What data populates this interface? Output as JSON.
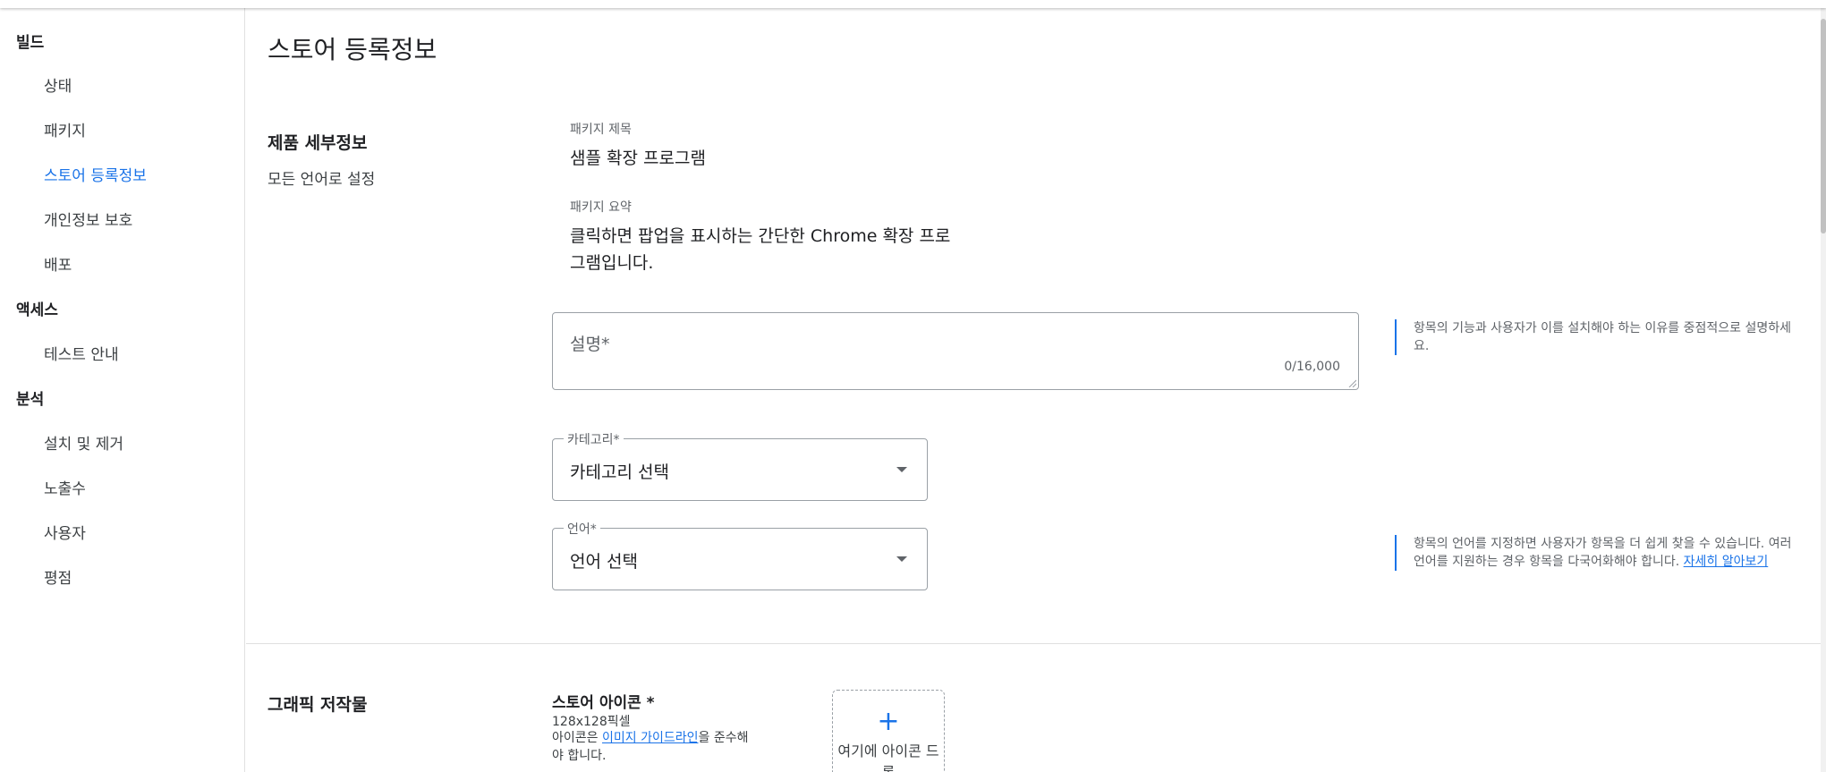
{
  "sidebar": {
    "sections": [
      {
        "label": "빌드",
        "items": [
          {
            "label": "상태"
          },
          {
            "label": "패키지"
          },
          {
            "label": "스토어 등록정보"
          },
          {
            "label": "개인정보 보호"
          },
          {
            "label": "배포"
          }
        ]
      },
      {
        "label": "액세스",
        "items": [
          {
            "label": "테스트 안내"
          }
        ]
      },
      {
        "label": "분석",
        "items": [
          {
            "label": "설치 및 제거"
          },
          {
            "label": "노출수"
          },
          {
            "label": "사용자"
          },
          {
            "label": "평점"
          }
        ]
      }
    ],
    "active_item": "스토어 등록정보"
  },
  "page": {
    "title": "스토어 등록정보"
  },
  "product_details": {
    "title": "제품 세부정보",
    "subtitle": "모든 언어로 설정",
    "package_title_label": "패키지 제목",
    "package_title_value": "샘플 확장 프로그램",
    "package_summary_label": "패키지 요약",
    "package_summary_value": "클릭하면 팝업을 표시하는 간단한 Chrome 확장 프로그램입니다.",
    "description": {
      "placeholder": "설명*",
      "counter": "0/16,000",
      "hint": "항목의 기능과 사용자가 이를 설치해야 하는 이유를 중점적으로 설명하세요."
    },
    "category": {
      "label": "카테고리*",
      "value": "카테고리 선택"
    },
    "language": {
      "label": "언어*",
      "value": "언어 선택",
      "hint": "항목의 언어를 지정하면 사용자가 항목을 더 쉽게 찾을 수 있습니다. 여러 언어를 지원하는 경우 항목을 다국어화해야 합니다. ",
      "hint_link": "자세히 알아보기"
    }
  },
  "graphics": {
    "title": "그래픽 저작물",
    "store_icon": {
      "title": "스토어 아이콘 *",
      "size": "128x128픽셀",
      "guideline_prefix": "아이콘은 ",
      "guideline_link": "이미지 가이드라인",
      "guideline_suffix": "을 준수해야 합니다.",
      "upload_plus": "+",
      "upload_text": "여기에 아이콘 드롭"
    }
  },
  "colors": {
    "accent": "#1a73e8",
    "border": "#9aa0a6",
    "text_primary": "#202124",
    "text_secondary": "#5f6368"
  }
}
